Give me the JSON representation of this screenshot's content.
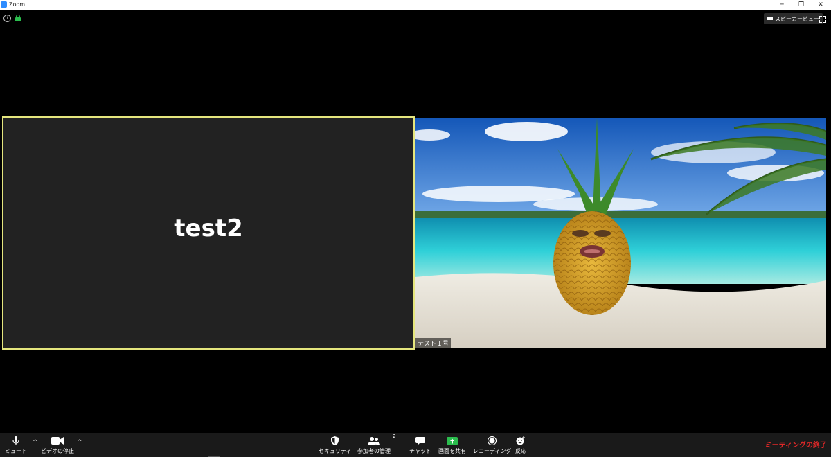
{
  "window": {
    "title": "Zoom",
    "min": "─",
    "restore": "❐",
    "close": "✕"
  },
  "top": {
    "info_glyph": "i",
    "speaker_view_label": "スピーカービュー"
  },
  "participants": {
    "left_name": "test2",
    "right_name_tag": "テスト１号"
  },
  "toolbar": {
    "mute": "ミュート",
    "stop_video": "ビデオの停止",
    "caret": "^",
    "security": "セキュリティ",
    "participants": "参加者の管理",
    "participants_count": "2",
    "chat": "チャット",
    "share_screen": "画面を共有",
    "recording": "レコーディング",
    "reactions": "反応",
    "end_meeting": "ミーティングの終了"
  },
  "colors": {
    "accent_border": "#e5e67e",
    "share_green": "#2bbd4e",
    "end_red": "#e02828",
    "brand_blue": "#2D8CFF"
  }
}
